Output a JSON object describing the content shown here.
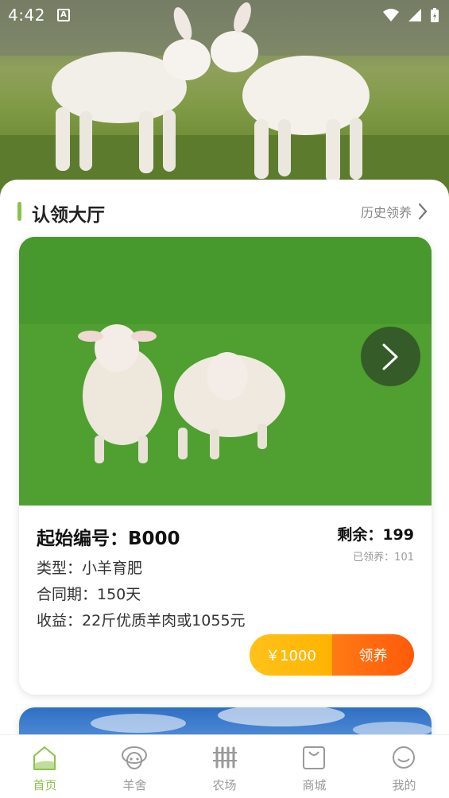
{
  "status_bar": {
    "time": "4:42",
    "notification_icon": "A",
    "icons": [
      "wifi-icon",
      "signal-icon",
      "battery-icon"
    ]
  },
  "section": {
    "title": "认领大厅",
    "history_link": "历史领养"
  },
  "card": {
    "code": "起始编号：B000",
    "remaining": "剩余：199",
    "adopted": "已领养：101",
    "type": "类型：小羊育肥",
    "contract": "合同期：150天",
    "income": "收益：22斤优质羊肉或1055元",
    "price": "￥1000",
    "adopt_button": "领养"
  },
  "tabs": [
    {
      "label": "首页",
      "icon": "home-icon",
      "active": true
    },
    {
      "label": "羊舍",
      "icon": "sheep-icon",
      "active": false
    },
    {
      "label": "农场",
      "icon": "fence-icon",
      "active": false
    },
    {
      "label": "商城",
      "icon": "shopping-bag-icon",
      "active": false
    },
    {
      "label": "我的",
      "icon": "smiley-icon",
      "active": false
    }
  ],
  "colors": {
    "accent_green": "#8bc34a",
    "price_yellow": "#ffb300",
    "adopt_orange": "#ff5a0a"
  }
}
